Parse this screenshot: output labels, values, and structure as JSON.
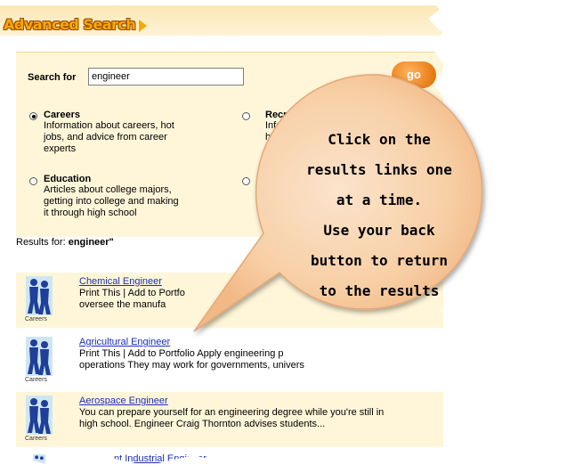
{
  "header": {
    "title": "Advanced Search"
  },
  "search": {
    "label": "Search for",
    "value": "engineer",
    "go_label": "go"
  },
  "options": [
    {
      "title": "Careers",
      "desc": [
        "Information about careers, hot",
        "jobs, and advice from career",
        "experts"
      ],
      "selected": true
    },
    {
      "title": "Recre",
      "desc": [
        "Infor",
        "ha"
      ],
      "selected": false
    },
    {
      "title": "Education",
      "desc": [
        "Articles about college majors,",
        "getting into college and making",
        "it through high school"
      ],
      "selected": false
    },
    {
      "title": "",
      "desc": [],
      "selected": false
    }
  ],
  "results_header": {
    "prefix": "Results for:",
    "term": "engineer\""
  },
  "results": [
    {
      "title": "Chemical Engineer",
      "lines": [
        "Print This | Add to Portfo",
        "oversee the manufa"
      ],
      "thumb_label": "Careers"
    },
    {
      "title": "Agricultural Engineer",
      "lines": [
        "Print This | Add to Portfolio Apply engineering p",
        "operations They may work for governments, univers"
      ],
      "thumb_label": "Careers"
    },
    {
      "title": "Aerospace Engineer",
      "lines": [
        "You can prepare yourself for an engineering degree while you're still in",
        "high school. Engineer Craig Thornton advises students..."
      ],
      "thumb_label": "Careers"
    },
    {
      "title": "nt Industrial Engineer",
      "lines": [],
      "thumb_label": ""
    }
  ],
  "callout": {
    "lines": [
      "Click on the",
      "results links one",
      "at a time.",
      "Use your back",
      "button to return",
      "to the results"
    ]
  },
  "colors": {
    "panel": "#fff6d9",
    "link": "#1a2fb8",
    "bubble": "#f6c596",
    "title": "#f6a900"
  }
}
